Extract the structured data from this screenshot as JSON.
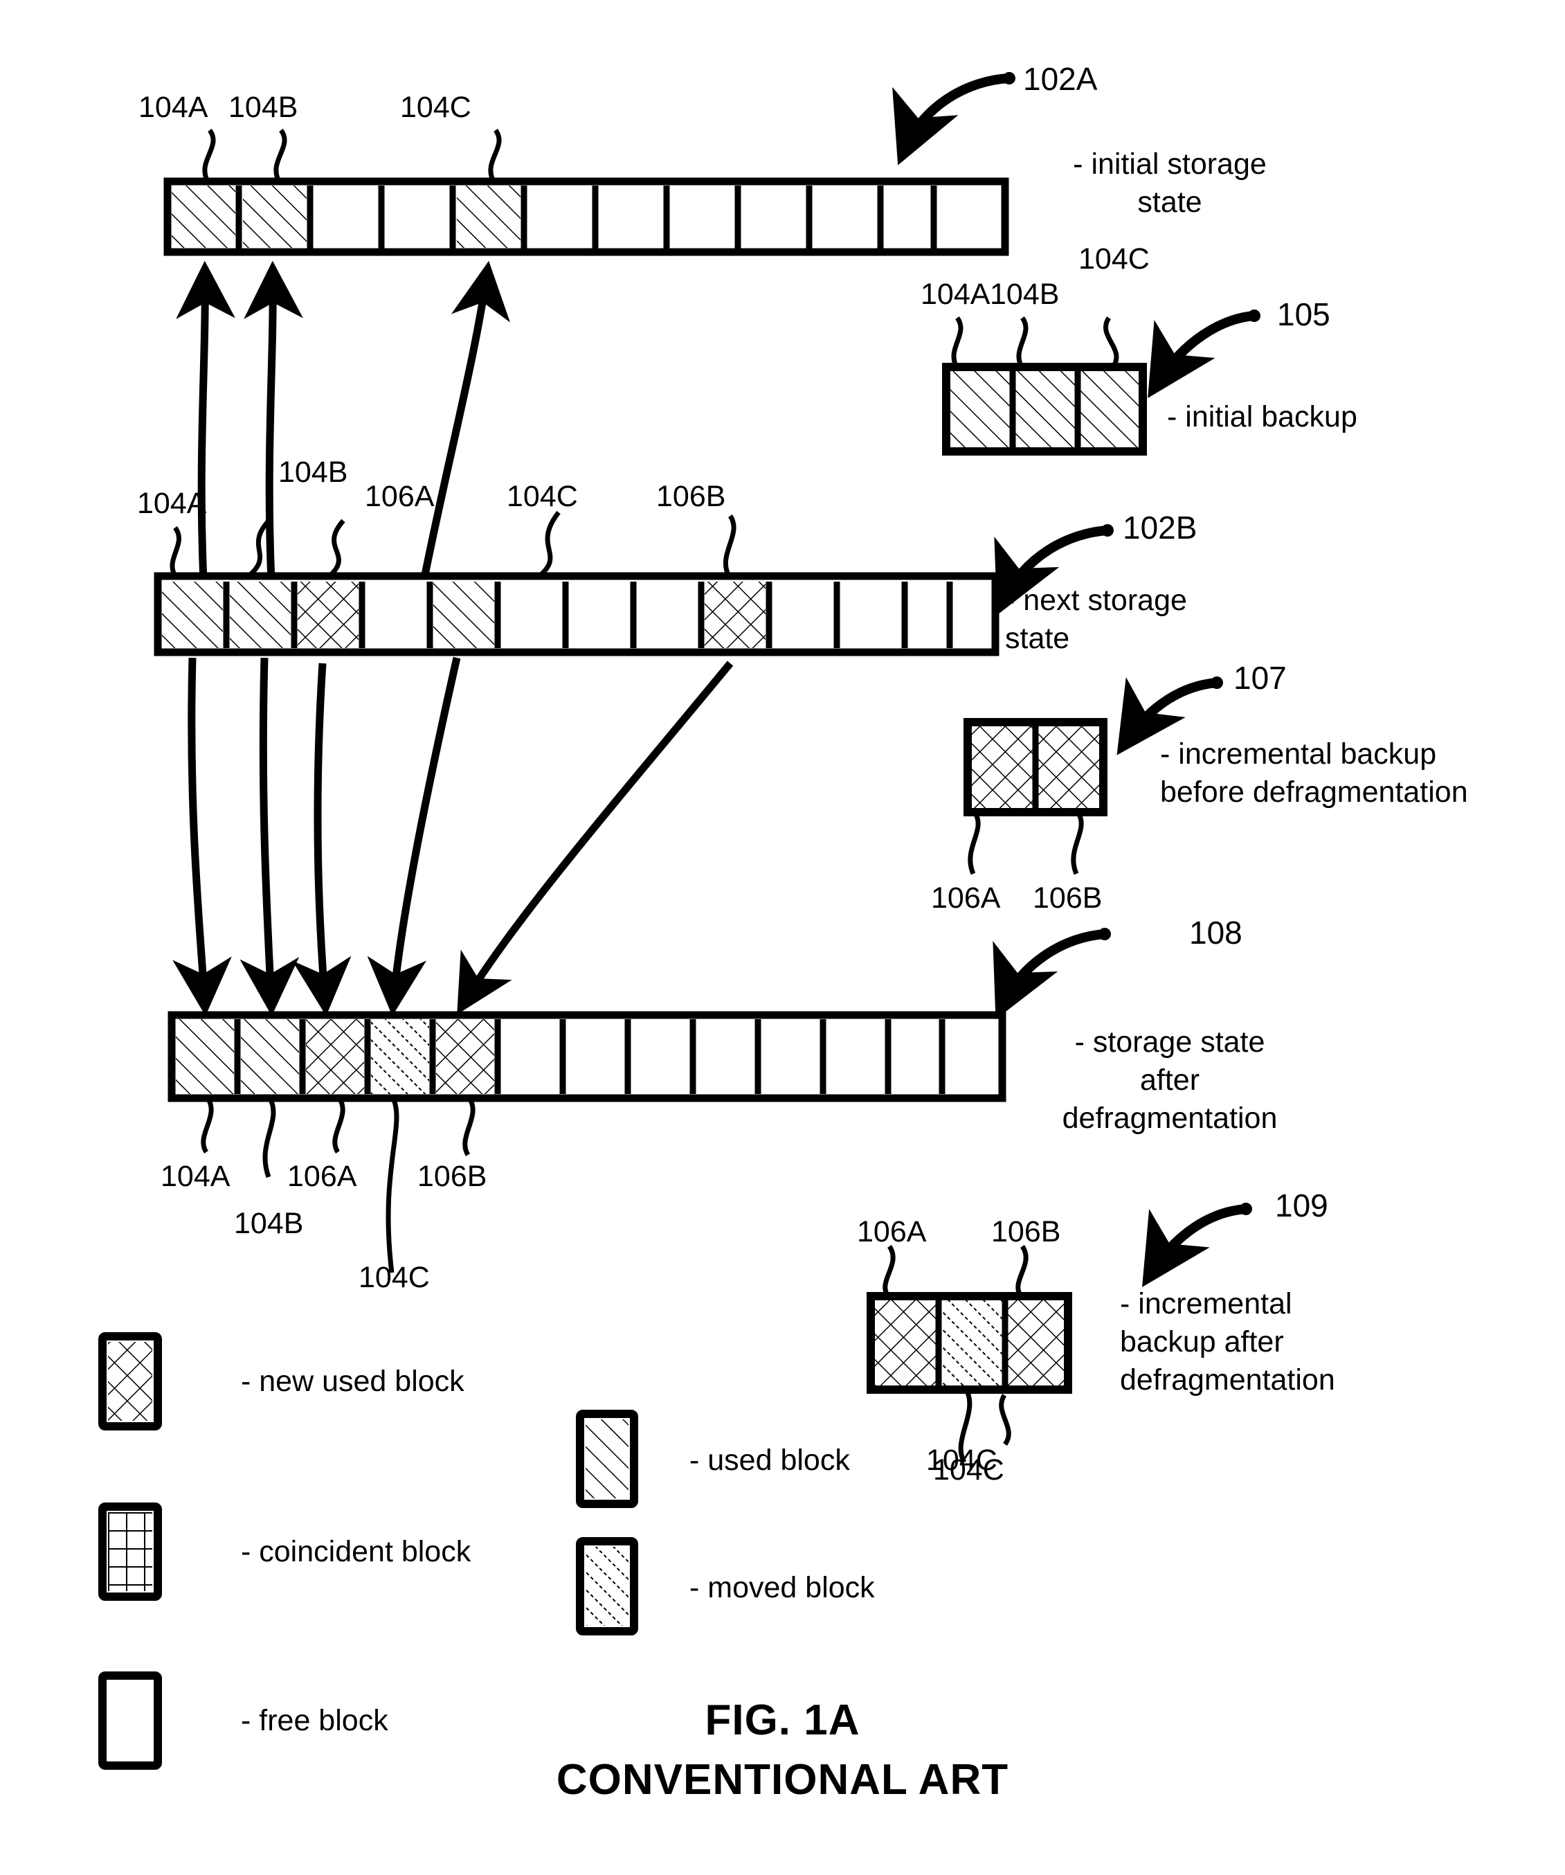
{
  "figure": {
    "title": "FIG. 1A",
    "subtitle": "CONVENTIONAL ART"
  },
  "callouts": {
    "storage_initial": "102A",
    "backup_initial": "105",
    "storage_next": "102B",
    "backup_incremental_before": "107",
    "storage_after_defrag": "108",
    "backup_incremental_after": "109"
  },
  "descriptions": {
    "storage_initial": "- initial storage\nstate",
    "backup_initial": "- initial backup",
    "storage_next": "- next storage\nstate",
    "backup_incremental_before": "- incremental backup\nbefore defragmentation",
    "storage_after_defrag": "- storage state\nafter\ndefragmentation",
    "backup_incremental_after": "- incremental\nbackup after\ndefragmentation"
  },
  "block_types": {
    "used": "used",
    "new_used": "new_used",
    "moved": "moved",
    "coincident": "coincident",
    "free": "free"
  },
  "storage_initial": {
    "id": "102A",
    "cell_count": 13,
    "cells": [
      "used",
      "used",
      "free",
      "free",
      "used",
      "free",
      "free",
      "free",
      "free",
      "free",
      "free",
      "free",
      "free"
    ],
    "labels_above": [
      {
        "text": "104A",
        "cell": 1
      },
      {
        "text": "104B",
        "cell": 2
      },
      {
        "text": "104C",
        "cell": 5
      }
    ]
  },
  "backup_initial": {
    "id": "105",
    "cell_count": 3,
    "cells": [
      "used",
      "used",
      "used"
    ],
    "labels_above": [
      {
        "text": "104A",
        "cell": 1
      },
      {
        "text": "104B",
        "cell": 2
      },
      {
        "text": "104C",
        "cell": 3
      }
    ]
  },
  "storage_next": {
    "id": "102B",
    "cell_count": 13,
    "cells": [
      "used",
      "used",
      "new_used",
      "free",
      "used",
      "free",
      "free",
      "free",
      "new_used",
      "free",
      "free",
      "free",
      "free"
    ],
    "labels_above": [
      {
        "text": "104A",
        "cell": 1
      },
      {
        "text": "104B",
        "cell": 2
      },
      {
        "text": "106A",
        "cell": 3
      },
      {
        "text": "104C",
        "cell": 5
      },
      {
        "text": "106B",
        "cell": 9
      }
    ]
  },
  "backup_incremental_before": {
    "id": "107",
    "cell_count": 2,
    "cells": [
      "new_used",
      "new_used"
    ],
    "labels_below": [
      {
        "text": "106A",
        "cell": 1
      },
      {
        "text": "106B",
        "cell": 2
      }
    ]
  },
  "storage_after_defrag": {
    "id": "108",
    "cell_count": 13,
    "cells": [
      "used",
      "used",
      "new_used",
      "moved",
      "new_used",
      "free",
      "free",
      "free",
      "free",
      "free",
      "free",
      "free",
      "free"
    ],
    "labels_below": [
      {
        "text": "104A",
        "cell": 1
      },
      {
        "text": "104B",
        "cell": 2
      },
      {
        "text": "106A",
        "cell": 3
      },
      {
        "text": "104C",
        "cell": 4
      },
      {
        "text": "106B",
        "cell": 5
      }
    ]
  },
  "backup_incremental_after": {
    "id": "109",
    "cell_count": 3,
    "cells": [
      "new_used",
      "moved",
      "new_used"
    ],
    "labels_above": [
      {
        "text": "106A",
        "cell": 1
      },
      {
        "text": "106B",
        "cell": 3
      }
    ],
    "labels_below": [
      {
        "text": "104C",
        "cell": 2
      }
    ]
  },
  "legend": {
    "items": [
      {
        "swatch": "new_used",
        "label": "- new used block"
      },
      {
        "swatch": "coincident",
        "label": "- coincident block"
      },
      {
        "swatch": "free",
        "label": "- free block"
      },
      {
        "swatch": "used",
        "label": "- used block"
      },
      {
        "swatch": "moved",
        "label": "- moved block"
      }
    ],
    "stray_ref": "104C"
  },
  "colors": {
    "ink": "#000000",
    "paper": "#ffffff"
  }
}
